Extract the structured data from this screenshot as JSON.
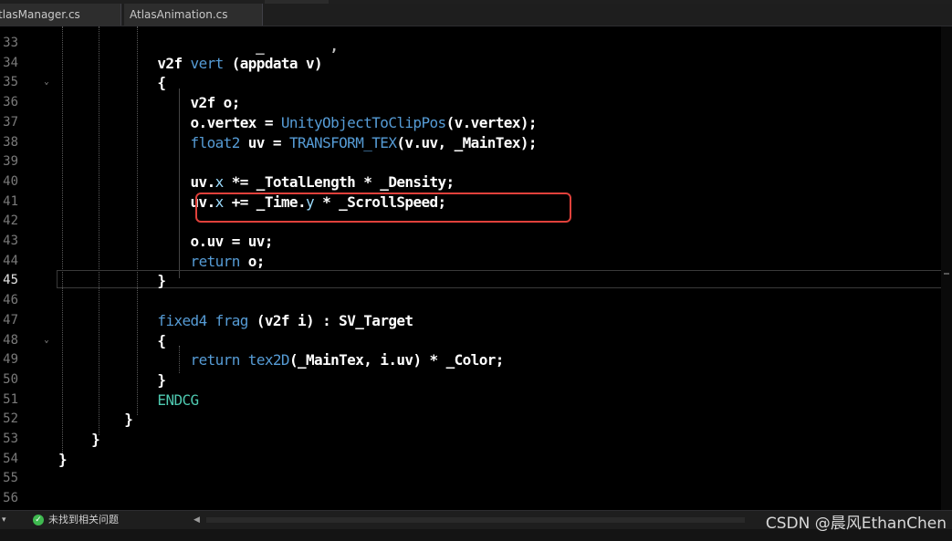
{
  "tabs": [
    {
      "label": "tlasManager.cs"
    },
    {
      "label": "AtlasAnimation.cs"
    }
  ],
  "top_partial_line": "_        ,",
  "line_numbers": [
    "33",
    "34",
    "35",
    "36",
    "37",
    "38",
    "39",
    "40",
    "41",
    "42",
    "43",
    "44",
    "45",
    "46",
    "47",
    "48",
    "49",
    "50",
    "51",
    "52",
    "53",
    "54",
    "55",
    "56"
  ],
  "active_line": "45",
  "code": [
    {
      "n": "33",
      "tokens": []
    },
    {
      "n": "34",
      "tokens": [
        {
          "t": "            v2f ",
          "c": "def"
        },
        {
          "t": "vert",
          "c": "fn"
        },
        {
          "t": " (appdata v)",
          "c": "def"
        }
      ]
    },
    {
      "n": "35",
      "tokens": [
        {
          "t": "            {",
          "c": "def"
        }
      ]
    },
    {
      "n": "36",
      "tokens": [
        {
          "t": "                v2f o;",
          "c": "def"
        }
      ]
    },
    {
      "n": "37",
      "tokens": [
        {
          "t": "                o.vertex = ",
          "c": "def"
        },
        {
          "t": "UnityObjectToClipPos",
          "c": "fn"
        },
        {
          "t": "(v.vertex);",
          "c": "def"
        }
      ]
    },
    {
      "n": "38",
      "tokens": [
        {
          "t": "                ",
          "c": "def"
        },
        {
          "t": "float2",
          "c": "kw"
        },
        {
          "t": " uv = ",
          "c": "def"
        },
        {
          "t": "TRANSFORM_TEX",
          "c": "fn"
        },
        {
          "t": "(v.uv, _MainTex);",
          "c": "def"
        }
      ]
    },
    {
      "n": "39",
      "tokens": []
    },
    {
      "n": "40",
      "tokens": [
        {
          "t": "                uv.",
          "c": "def"
        },
        {
          "t": "x",
          "c": "mem"
        },
        {
          "t": " *= _TotalLength * _Density;",
          "c": "def"
        }
      ]
    },
    {
      "n": "41",
      "tokens": [
        {
          "t": "                uv.",
          "c": "def"
        },
        {
          "t": "x",
          "c": "mem"
        },
        {
          "t": " += _Time.",
          "c": "def"
        },
        {
          "t": "y",
          "c": "mem"
        },
        {
          "t": " * _ScrollSpeed;",
          "c": "def"
        }
      ]
    },
    {
      "n": "42",
      "tokens": []
    },
    {
      "n": "43",
      "tokens": [
        {
          "t": "                o.uv = uv;",
          "c": "def"
        }
      ]
    },
    {
      "n": "44",
      "tokens": [
        {
          "t": "                ",
          "c": "def"
        },
        {
          "t": "return",
          "c": "kw"
        },
        {
          "t": " o;",
          "c": "def"
        }
      ]
    },
    {
      "n": "45",
      "tokens": [
        {
          "t": "            }",
          "c": "def"
        }
      ]
    },
    {
      "n": "46",
      "tokens": []
    },
    {
      "n": "47",
      "tokens": [
        {
          "t": "            ",
          "c": "def"
        },
        {
          "t": "fixed4",
          "c": "kw"
        },
        {
          "t": " ",
          "c": "def"
        },
        {
          "t": "frag",
          "c": "fn"
        },
        {
          "t": " (v2f i) : SV_Target",
          "c": "def"
        }
      ]
    },
    {
      "n": "48",
      "tokens": [
        {
          "t": "            {",
          "c": "def"
        }
      ]
    },
    {
      "n": "49",
      "tokens": [
        {
          "t": "                ",
          "c": "def"
        },
        {
          "t": "return",
          "c": "kw"
        },
        {
          "t": " ",
          "c": "def"
        },
        {
          "t": "tex2D",
          "c": "fn"
        },
        {
          "t": "(_MainTex, i.uv) * _Color;",
          "c": "def"
        }
      ]
    },
    {
      "n": "50",
      "tokens": [
        {
          "t": "            }",
          "c": "def"
        }
      ]
    },
    {
      "n": "51",
      "tokens": [
        {
          "t": "            ",
          "c": "def"
        },
        {
          "t": "ENDCG",
          "c": "str"
        }
      ]
    },
    {
      "n": "52",
      "tokens": [
        {
          "t": "        }",
          "c": "def"
        }
      ]
    },
    {
      "n": "53",
      "tokens": [
        {
          "t": "    }",
          "c": "def"
        }
      ]
    },
    {
      "n": "54",
      "tokens": [
        {
          "t": "}",
          "c": "def"
        }
      ]
    },
    {
      "n": "55",
      "tokens": []
    },
    {
      "n": "56",
      "tokens": []
    }
  ],
  "status": {
    "zoom_arrow": "▾",
    "ok_icon": "✓",
    "message": "未找到相关问题",
    "scroll_left": "◀"
  },
  "watermark": "CSDN @晨风EthanChen"
}
